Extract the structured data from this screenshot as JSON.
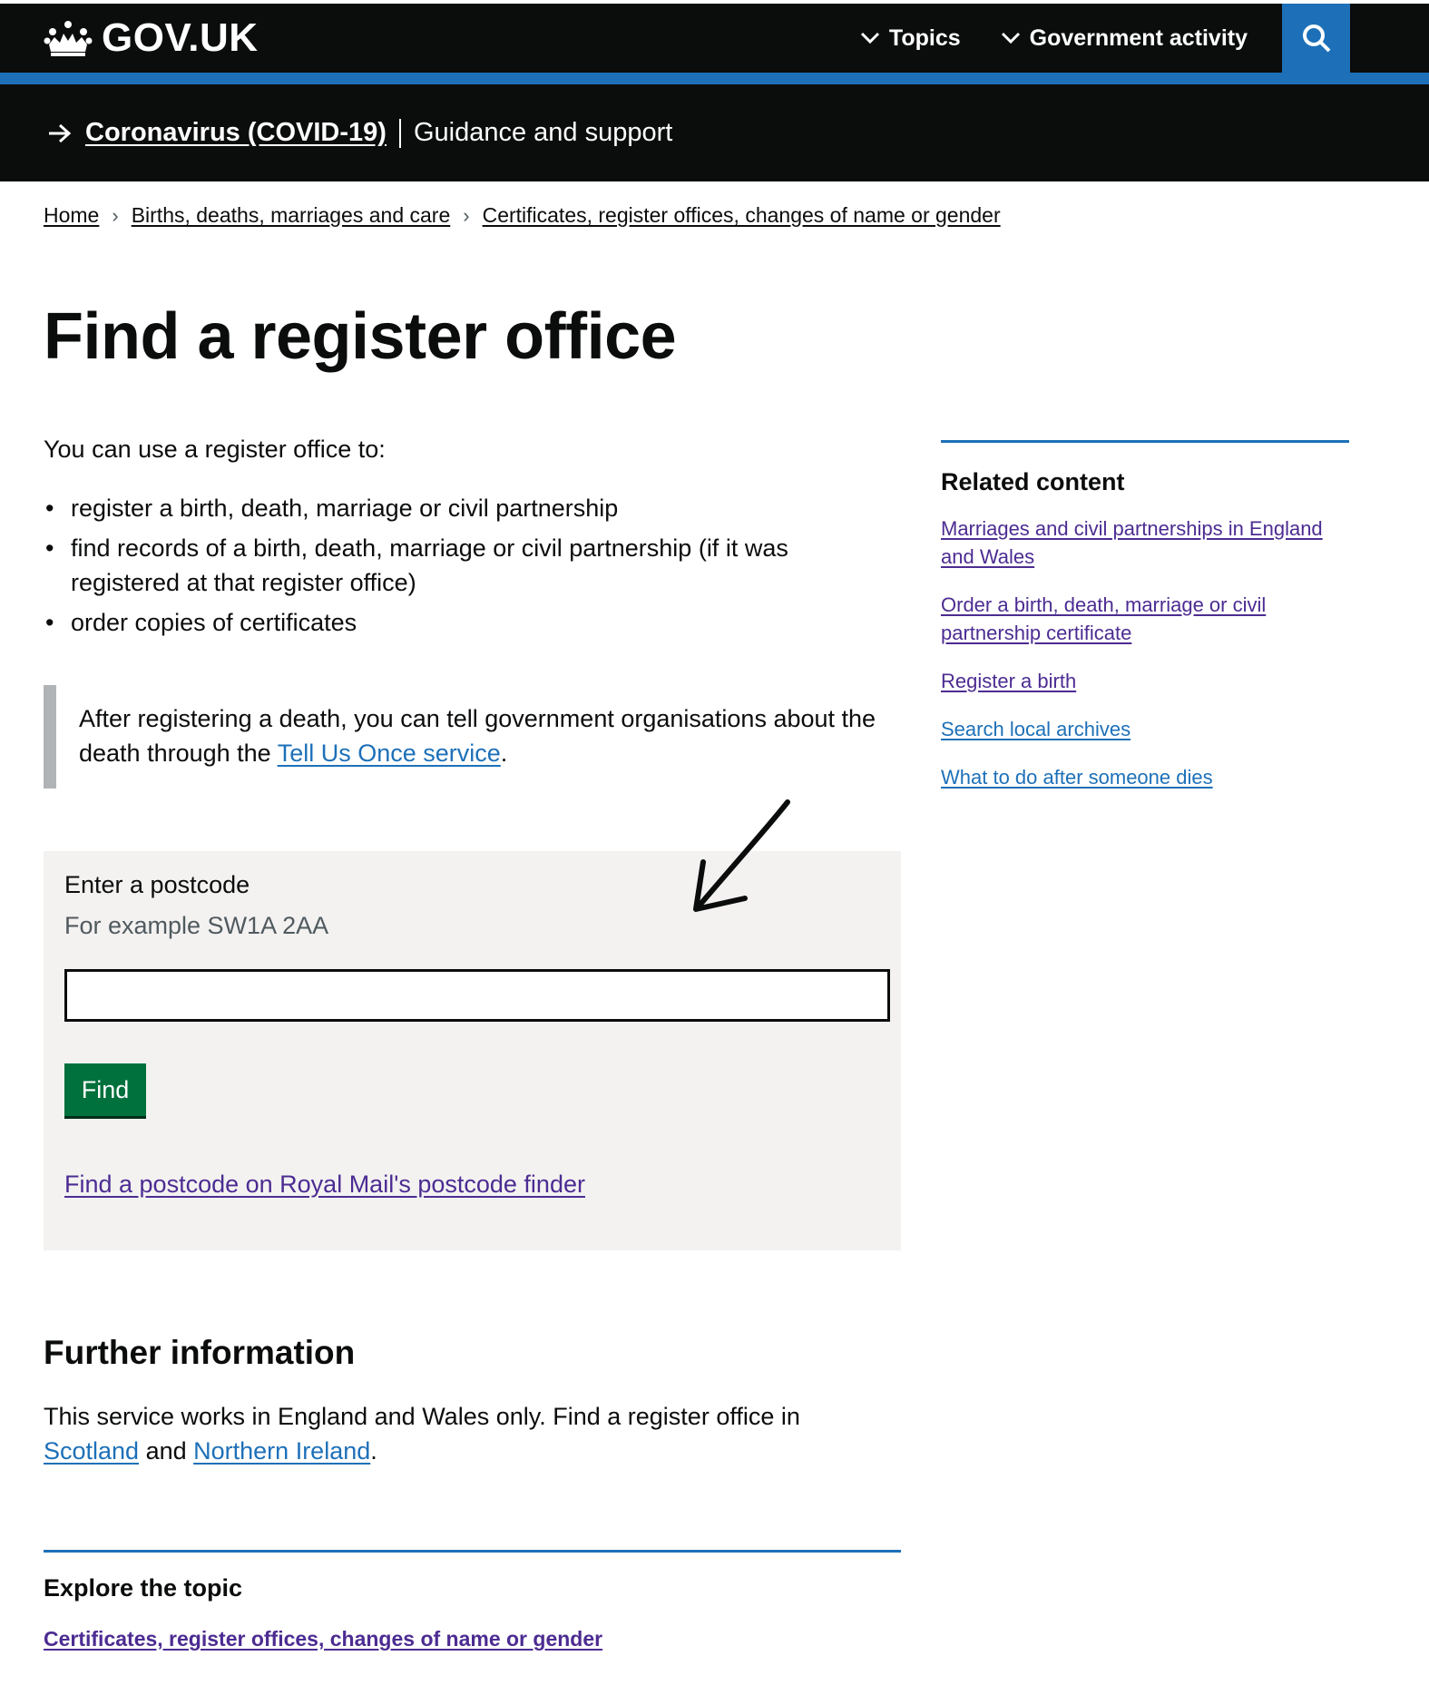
{
  "header": {
    "logo_text": "GOV.UK",
    "nav": [
      {
        "label": "Topics"
      },
      {
        "label": "Government activity"
      }
    ]
  },
  "covid": {
    "link": "Coronavirus (COVID-19)",
    "text": "Guidance and support"
  },
  "breadcrumb": [
    "Home",
    "Births, deaths, marriages and care",
    "Certificates, register offices, changes of name or gender"
  ],
  "page": {
    "title": "Find a register office",
    "intro": "You can use a register office to:",
    "bullets": [
      "register a birth, death, marriage or civil partnership",
      "find records of a birth, death, marriage or civil partnership (if it was registered at that register office)",
      "order copies of certificates"
    ],
    "inset": {
      "text_before": "After registering a death, you can tell government organisations about the death through the ",
      "link": "Tell Us Once service",
      "text_after": "."
    }
  },
  "form": {
    "label": "Enter a postcode",
    "hint": "For example SW1A 2AA",
    "value": "",
    "button": "Find",
    "finder_link": "Find a postcode on Royal Mail's postcode finder"
  },
  "further": {
    "title": "Further information",
    "text_before": "This service works in England and Wales only. Find a register office in ",
    "link1": "Scotland",
    "text_mid": " and ",
    "link2": "Northern Ireland",
    "text_after": "."
  },
  "explore": {
    "title": "Explore the topic",
    "link": "Certificates, register offices, changes of name or gender"
  },
  "sidebar": {
    "title": "Related content",
    "links": [
      "Marriages and civil partnerships in England and Wales",
      "Order a birth, death, marriage or civil partnership certificate",
      "Register a birth",
      "Search local archives",
      "What to do after someone dies"
    ]
  },
  "colors": {
    "link_blue": "#1d70b8",
    "visited_purple": "#4c2c92",
    "button_green": "#00703c",
    "header_black": "#0b0c0c"
  }
}
